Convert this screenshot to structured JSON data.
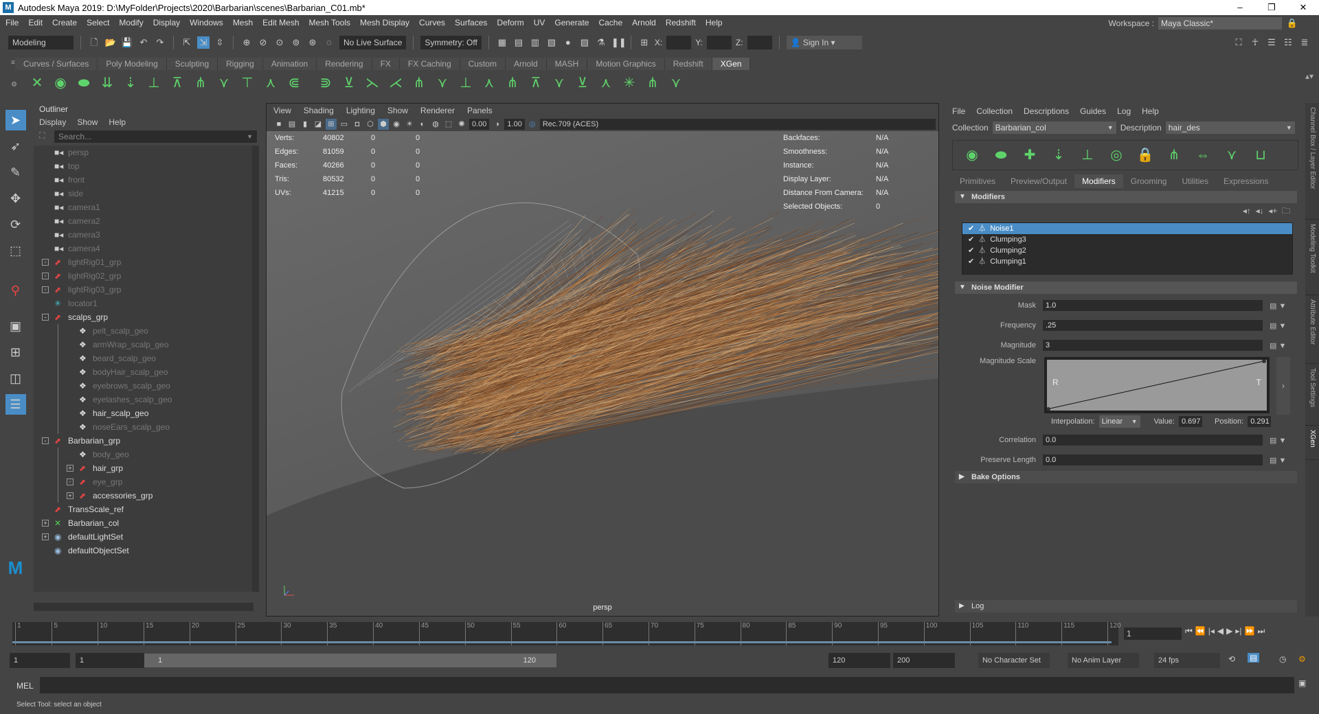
{
  "window": {
    "title": "Autodesk Maya 2019: D:\\MyFolder\\Projects\\2020\\Barbarian\\scenes\\Barbarian_C01.mb*",
    "logo": "M",
    "controls": [
      "–",
      "❐",
      "✕"
    ]
  },
  "menubar": [
    "File",
    "Edit",
    "Create",
    "Select",
    "Modify",
    "Display",
    "Windows",
    "Mesh",
    "Edit Mesh",
    "Mesh Tools",
    "Mesh Display",
    "Curves",
    "Surfaces",
    "Deform",
    "UV",
    "Generate",
    "Cache",
    "Arnold",
    "Redshift",
    "Help"
  ],
  "workspace": {
    "label": "Workspace :",
    "value": "Maya Classic*"
  },
  "statusline": {
    "menuset": "Modeling",
    "live_surface": "No Live Surface",
    "symmetry": "Symmetry: Off",
    "x_label": "X:",
    "y_label": "Y:",
    "z_label": "Z:",
    "sign_in": "Sign In"
  },
  "shelf": {
    "tabs": [
      "Curves / Surfaces",
      "Poly Modeling",
      "Sculpting",
      "Rigging",
      "Animation",
      "Rendering",
      "FX",
      "FX Caching",
      "Custom",
      "Arnold",
      "MASH",
      "Motion Graphics",
      "Redshift",
      "XGen"
    ],
    "active": "XGen"
  },
  "outliner": {
    "title": "Outliner",
    "menu": [
      "Display",
      "Show",
      "Help"
    ],
    "search_placeholder": "Search...",
    "items": [
      {
        "label": "persp",
        "icon": "camera",
        "depth": 0,
        "dim": true
      },
      {
        "label": "top",
        "icon": "camera",
        "depth": 0,
        "dim": true
      },
      {
        "label": "front",
        "icon": "camera",
        "depth": 0,
        "dim": true
      },
      {
        "label": "side",
        "icon": "camera",
        "depth": 0,
        "dim": true
      },
      {
        "label": "camera1",
        "icon": "camera",
        "depth": 0,
        "dim": true
      },
      {
        "label": "camera2",
        "icon": "camera",
        "depth": 0,
        "dim": true
      },
      {
        "label": "camera3",
        "icon": "camera",
        "depth": 0,
        "dim": true
      },
      {
        "label": "camera4",
        "icon": "camera",
        "depth": 0,
        "dim": true
      },
      {
        "label": "lightRig01_grp",
        "icon": "group",
        "depth": 0,
        "dim": true,
        "expand": "+"
      },
      {
        "label": "lightRig02_grp",
        "icon": "group",
        "depth": 0,
        "dim": true,
        "expand": "+"
      },
      {
        "label": "lightRig03_grp",
        "icon": "group",
        "depth": 0,
        "dim": true,
        "expand": "+"
      },
      {
        "label": "locator1",
        "icon": "locator",
        "depth": 0,
        "dim": true
      },
      {
        "label": "scalps_grp",
        "icon": "group",
        "depth": 0,
        "dim": false,
        "expand": "-"
      },
      {
        "label": "pelt_scalp_geo",
        "icon": "mesh",
        "depth": 1,
        "dim": true
      },
      {
        "label": "armWrap_scalp_geo",
        "icon": "mesh",
        "depth": 1,
        "dim": true
      },
      {
        "label": "beard_scalp_geo",
        "icon": "mesh",
        "depth": 1,
        "dim": true
      },
      {
        "label": "bodyHair_scalp_geo",
        "icon": "mesh",
        "depth": 1,
        "dim": true
      },
      {
        "label": "eyebrows_scalp_geo",
        "icon": "mesh",
        "depth": 1,
        "dim": true
      },
      {
        "label": "eyelashes_scalp_geo",
        "icon": "mesh",
        "depth": 1,
        "dim": true
      },
      {
        "label": "hair_scalp_geo",
        "icon": "mesh",
        "depth": 1,
        "dim": false
      },
      {
        "label": "noseEars_scalp_geo",
        "icon": "mesh",
        "depth": 1,
        "dim": true
      },
      {
        "label": "Barbarian_grp",
        "icon": "group",
        "depth": 0,
        "dim": false,
        "expand": "-"
      },
      {
        "label": "body_geo",
        "icon": "mesh",
        "depth": 1,
        "dim": true
      },
      {
        "label": "hair_grp",
        "icon": "group",
        "depth": 1,
        "dim": false,
        "expand": "+"
      },
      {
        "label": "eye_grp",
        "icon": "group",
        "depth": 1,
        "dim": true,
        "expand": "+"
      },
      {
        "label": "accessories_grp",
        "icon": "group",
        "depth": 1,
        "dim": false,
        "expand": "+"
      },
      {
        "label": "TransScale_ref",
        "icon": "group",
        "depth": 0,
        "dim": false
      },
      {
        "label": "Barbarian_col",
        "icon": "xgen",
        "depth": 0,
        "dim": false,
        "expand": "+"
      },
      {
        "label": "defaultLightSet",
        "icon": "set",
        "depth": 0,
        "dim": false,
        "expand": "+"
      },
      {
        "label": "defaultObjectSet",
        "icon": "set",
        "depth": 0,
        "dim": false
      }
    ]
  },
  "viewport": {
    "menu": [
      "View",
      "Shading",
      "Lighting",
      "Show",
      "Renderer",
      "Panels"
    ],
    "exposure": "0.00",
    "gamma": "1.00",
    "color_space": "Rec.709 (ACES)",
    "stats": [
      [
        "Verts:",
        "40802",
        "0",
        "0"
      ],
      [
        "Edges:",
        "81059",
        "0",
        "0"
      ],
      [
        "Faces:",
        "40266",
        "0",
        "0"
      ],
      [
        "Tris:",
        "80532",
        "0",
        "0"
      ],
      [
        "UVs:",
        "41215",
        "0",
        "0"
      ]
    ],
    "info": [
      [
        "Backfaces:",
        "N/A"
      ],
      [
        "Smoothness:",
        "N/A"
      ],
      [
        "Instance:",
        "N/A"
      ],
      [
        "Display Layer:",
        "N/A"
      ],
      [
        "Distance From Camera:",
        "N/A"
      ],
      [
        "Selected Objects:",
        "0"
      ]
    ],
    "camera": "persp"
  },
  "xgen": {
    "menu": [
      "File",
      "Collection",
      "Descriptions",
      "Guides",
      "Log",
      "Help"
    ],
    "collection_label": "Collection",
    "collection": "Barbarian_col",
    "description_label": "Description",
    "description": "hair_des",
    "tabs": [
      "Primitives",
      "Preview/Output",
      "Modifiers",
      "Grooming",
      "Utilities",
      "Expressions"
    ],
    "active_tab": "Modifiers",
    "modifiers_section": "Modifiers",
    "modifiers": [
      {
        "name": "Noise1",
        "checked": true,
        "selected": true
      },
      {
        "name": "Clumping3",
        "checked": true
      },
      {
        "name": "Clumping2",
        "checked": true
      },
      {
        "name": "Clumping1",
        "checked": true
      }
    ],
    "noise_section": "Noise Modifier",
    "fields": {
      "mask_label": "Mask",
      "mask": "1.0",
      "frequency_label": "Frequency",
      "frequency": ".25",
      "magnitude_label": "Magnitude",
      "magnitude": "3",
      "magnitude_scale_label": "Magnitude Scale",
      "ramp_left": "R",
      "ramp_right": "T",
      "interpolation_label": "Interpolation:",
      "interpolation": "Linear",
      "value_label": "Value:",
      "value": "0.697",
      "position_label": "Position:",
      "position": "0.291",
      "correlation_label": "Correlation",
      "correlation": "0.0",
      "preserve_length_label": "Preserve Length",
      "preserve_length": "0.0"
    },
    "bake_section": "Bake Options",
    "log_section": "Log"
  },
  "side_tabs": [
    "Channel Box / Layer Editor",
    "Modeling Toolkit",
    "Attribute Editor",
    "Tool Settings",
    "XGen"
  ],
  "timeline": {
    "ticks": [
      "1",
      "5",
      "10",
      "15",
      "20",
      "25",
      "30",
      "35",
      "40",
      "45",
      "50",
      "55",
      "60",
      "65",
      "70",
      "75",
      "80",
      "85",
      "90",
      "95",
      "100",
      "105",
      "110",
      "115",
      "120"
    ],
    "current": "1",
    "range_start": "1",
    "playback_start": "1",
    "range_inner_start": "1",
    "range_inner_end": "120",
    "playback_end": "120",
    "range_end": "200",
    "character_set": "No Character Set",
    "anim_layer": "No Anim Layer",
    "fps": "24 fps"
  },
  "commandline": {
    "label": "MEL"
  },
  "helpline": "Select Tool: select an object"
}
